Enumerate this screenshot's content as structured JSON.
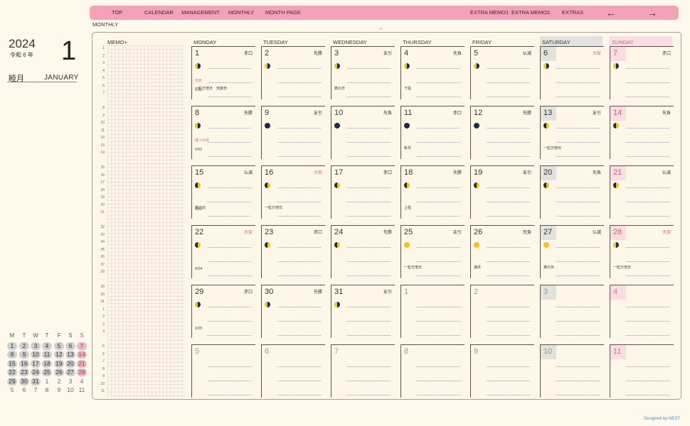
{
  "nav": {
    "items": [
      "TOP",
      "CALENDAR",
      "MANAGEMENT",
      "MONTHLY",
      "MONTH PAGE",
      "EXTRA MEMO1",
      "EXTRA MEMO2",
      "EXTRAS"
    ],
    "prev_arrow": "←",
    "next_arrow": "→"
  },
  "page_title": "MONTHLY",
  "header": {
    "year": "2024",
    "era": "令和 6 年",
    "month_number": "1",
    "month_jp": "睦月",
    "month_en": "JANUARY"
  },
  "memo_label": "MEMO+",
  "weekdays": [
    "MONDAY",
    "TUESDAY",
    "WEDNESDAY",
    "THURSDAY",
    "FRIDAY",
    "SATURDAY",
    "SUNDAY"
  ],
  "row_numbers": [
    [
      "1",
      "2",
      "3",
      "4",
      "5",
      "6",
      "7"
    ],
    [
      "8",
      "9",
      "10",
      "11",
      "12",
      "13",
      "14"
    ],
    [
      "15",
      "16",
      "17",
      "18",
      "19",
      "20",
      "21"
    ],
    [
      "22",
      "23",
      "24",
      "25",
      "26",
      "27",
      "28"
    ],
    [
      "29",
      "30",
      "31",
      "1",
      "2",
      "3",
      "4"
    ],
    [
      "5",
      "6",
      "7",
      "8",
      "9",
      "10",
      "11"
    ]
  ],
  "weeks": [
    {
      "week_label": "W01",
      "days": [
        {
          "num": "1",
          "rokuyo": "赤口",
          "moon": "waning",
          "holiday": "元日",
          "events": [
            "一粒万倍日",
            "天赦日"
          ]
        },
        {
          "num": "2",
          "rokuyo": "先勝",
          "moon": "waning",
          "events": []
        },
        {
          "num": "3",
          "rokuyo": "友引",
          "moon": "waning",
          "events": [
            "寅の日"
          ]
        },
        {
          "num": "4",
          "rokuyo": "先負",
          "moon": "waning",
          "events": [
            "下弦"
          ]
        },
        {
          "num": "5",
          "rokuyo": "仏滅",
          "moon": "waning",
          "events": []
        },
        {
          "num": "6",
          "rokuyo": "大安",
          "rokuyo_red": true,
          "moon": "waning",
          "events": []
        },
        {
          "num": "7",
          "rokuyo": "赤口",
          "moon": "waning",
          "events": []
        }
      ]
    },
    {
      "week_label": "W02",
      "days": [
        {
          "num": "8",
          "rokuyo": "先勝",
          "moon": "waning",
          "holiday": "成人の日",
          "events": []
        },
        {
          "num": "9",
          "rokuyo": "友引",
          "moon": "new",
          "events": []
        },
        {
          "num": "10",
          "rokuyo": "先負",
          "moon": "new",
          "events": []
        },
        {
          "num": "11",
          "rokuyo": "赤口",
          "moon": "new",
          "events": [
            "新月"
          ]
        },
        {
          "num": "12",
          "rokuyo": "先勝",
          "moon": "new",
          "events": []
        },
        {
          "num": "13",
          "rokuyo": "友引",
          "moon": "waxing",
          "events": [
            "一粒万倍日"
          ]
        },
        {
          "num": "14",
          "rokuyo": "先負",
          "moon": "waxing",
          "events": []
        }
      ]
    },
    {
      "week_label": "W03",
      "days": [
        {
          "num": "15",
          "rokuyo": "仏滅",
          "moon": "waxing",
          "events": [
            "寅の日"
          ]
        },
        {
          "num": "16",
          "rokuyo": "大安",
          "rokuyo_red": true,
          "moon": "waxing",
          "events": [
            "一粒万倍日"
          ]
        },
        {
          "num": "17",
          "rokuyo": "赤口",
          "moon": "waxing",
          "events": []
        },
        {
          "num": "18",
          "rokuyo": "先勝",
          "moon": "waxing",
          "events": [
            "上弦"
          ]
        },
        {
          "num": "19",
          "rokuyo": "友引",
          "moon": "waxing",
          "events": []
        },
        {
          "num": "20",
          "rokuyo": "先負",
          "moon": "waxing",
          "events": []
        },
        {
          "num": "21",
          "rokuyo": "仏滅",
          "moon": "waxing",
          "events": []
        }
      ]
    },
    {
      "week_label": "W04",
      "days": [
        {
          "num": "22",
          "rokuyo": "大安",
          "rokuyo_red": true,
          "moon": "waxing",
          "events": []
        },
        {
          "num": "23",
          "rokuyo": "赤口",
          "moon": "waxing",
          "events": []
        },
        {
          "num": "24",
          "rokuyo": "先勝",
          "moon": "waxing",
          "events": []
        },
        {
          "num": "25",
          "rokuyo": "友引",
          "moon": "full",
          "events": [
            "一粒万倍日"
          ]
        },
        {
          "num": "26",
          "rokuyo": "先負",
          "moon": "full",
          "events": [
            "満月"
          ]
        },
        {
          "num": "27",
          "rokuyo": "仏滅",
          "moon": "full",
          "events": [
            "寅の日"
          ]
        },
        {
          "num": "28",
          "rokuyo": "大安",
          "rokuyo_red": true,
          "moon": "waning",
          "events": [
            "一粒万倍日"
          ]
        }
      ]
    },
    {
      "week_label": "W05",
      "days": [
        {
          "num": "29",
          "rokuyo": "赤口",
          "moon": "waning",
          "events": []
        },
        {
          "num": "30",
          "rokuyo": "先勝",
          "moon": "waning",
          "events": []
        },
        {
          "num": "31",
          "rokuyo": "友引",
          "moon": "waning",
          "events": []
        },
        {
          "num": "1",
          "other": true,
          "events": []
        },
        {
          "num": "2",
          "other": true,
          "events": []
        },
        {
          "num": "3",
          "other": true,
          "events": []
        },
        {
          "num": "4",
          "other": true,
          "events": []
        }
      ]
    },
    {
      "week_label": "",
      "days": [
        {
          "num": "5",
          "other": true,
          "events": []
        },
        {
          "num": "6",
          "other": true,
          "events": []
        },
        {
          "num": "7",
          "other": true,
          "events": []
        },
        {
          "num": "8",
          "other": true,
          "events": []
        },
        {
          "num": "9",
          "other": true,
          "events": []
        },
        {
          "num": "10",
          "other": true,
          "events": []
        },
        {
          "num": "11",
          "other": true,
          "events": []
        }
      ]
    }
  ],
  "mini_calendar": {
    "headers": [
      "M",
      "T",
      "W",
      "T",
      "F",
      "S",
      "S"
    ],
    "rows": [
      [
        "1",
        "2",
        "3",
        "4",
        "5",
        "6",
        "7"
      ],
      [
        "8",
        "9",
        "10",
        "11",
        "12",
        "13",
        "14"
      ],
      [
        "15",
        "16",
        "17",
        "18",
        "19",
        "20",
        "21"
      ],
      [
        "22",
        "23",
        "24",
        "25",
        "26",
        "27",
        "28"
      ],
      [
        "29",
        "30",
        "31",
        "1",
        "2",
        "3",
        "4"
      ],
      [
        "5",
        "6",
        "7",
        "8",
        "9",
        "10",
        "11"
      ]
    ],
    "current_month_count": 31
  },
  "credit": "Designed by NEST",
  "colors": {
    "accent": "#f4a3b6",
    "background": "#fff8ec",
    "sunday": "#d0607a",
    "saturday_fill": "#e4e2df",
    "sunday_fill": "#f9dde2"
  }
}
